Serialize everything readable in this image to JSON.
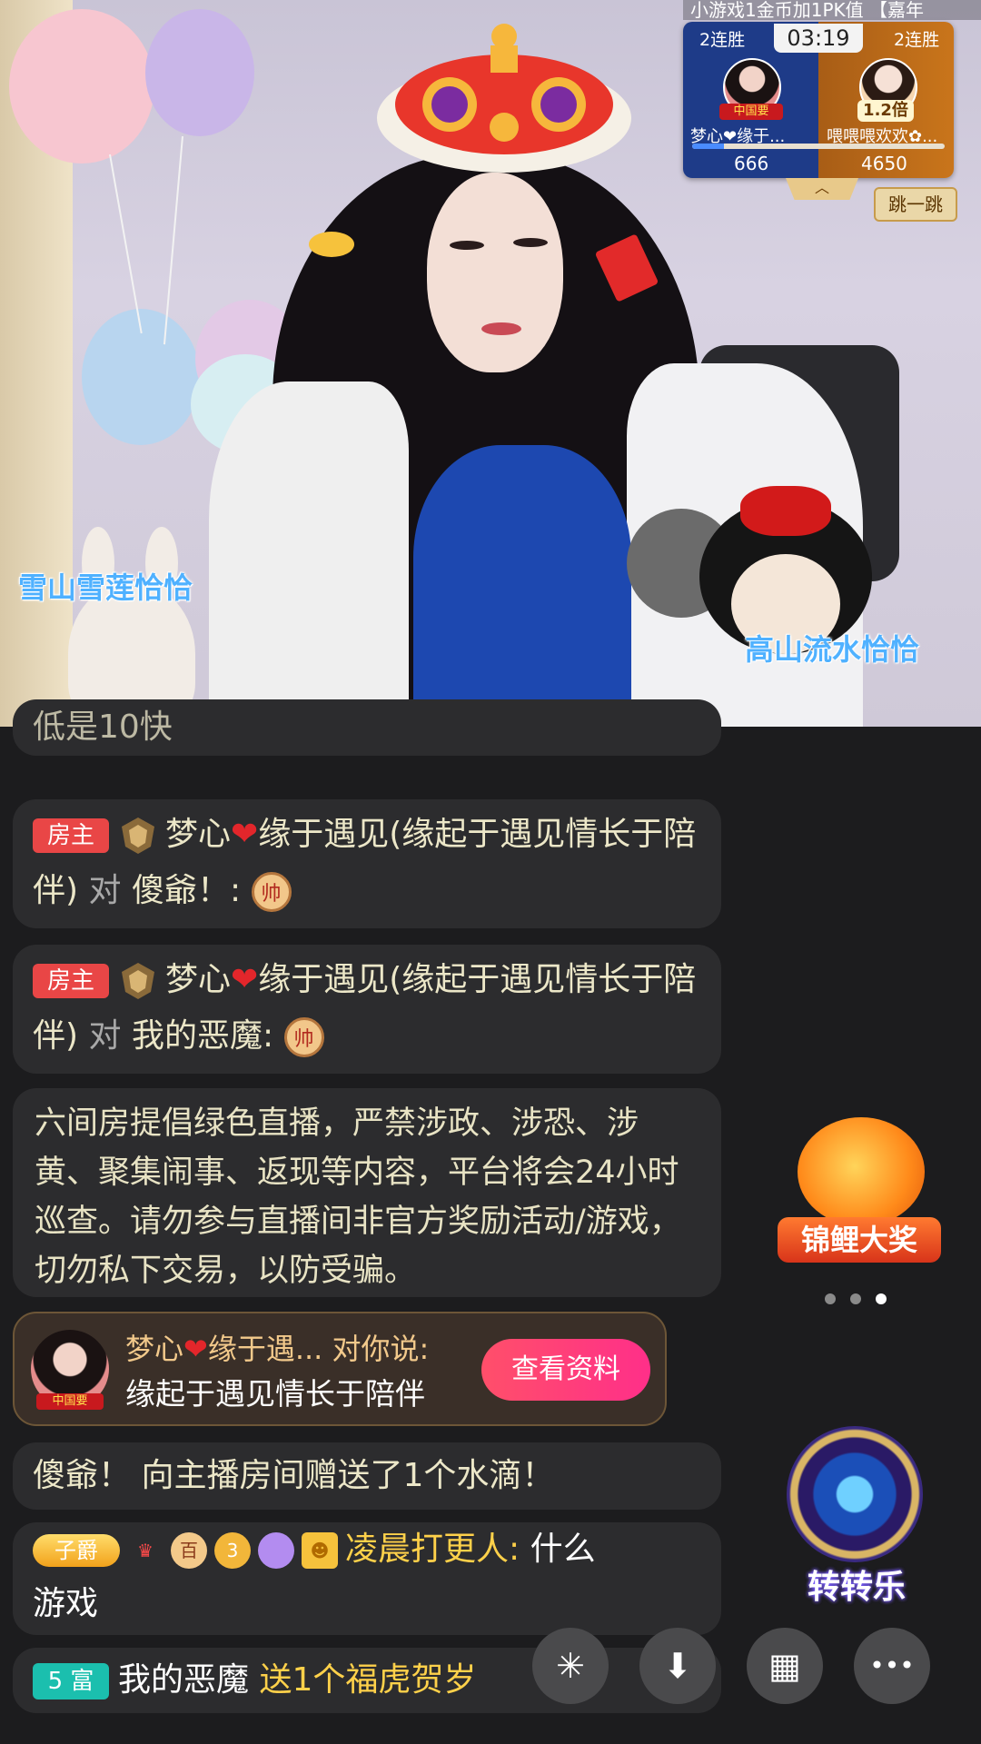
{
  "video": {
    "ticker_text": "小游戏1金币加1PK值 【嘉年",
    "overlay_name_left": "雪山雪莲恰恰",
    "overlay_name_right": "高山流水恰恰"
  },
  "pk": {
    "left_streak": "2连胜",
    "right_streak": "2连胜",
    "timer": "03:19",
    "left_tag": "中国要",
    "multiplier": "1.2倍",
    "left_name": "梦心❤缘于...",
    "right_name": "喂喂喂欢欢✿...",
    "left_score": "666",
    "right_score": "4650",
    "progress": 0.125,
    "expand_glyph": "︿",
    "skip_label": "跳一跳",
    "colors": {
      "left_team": "#1e3b88",
      "right_team": "#c9751b",
      "bar": "#4a8cff"
    }
  },
  "chat": {
    "partial_top": "低是10快",
    "messages": [
      {
        "badge": "房主",
        "sender_prefix": "梦心",
        "heart": "❤",
        "sender_rest": "缘于遇见(缘起于遇见情长于陪伴)",
        "connector": "对",
        "target": "傻爺！:",
        "gift_glyph": "帅"
      },
      {
        "badge": "房主",
        "sender_prefix": "梦心",
        "heart": "❤",
        "sender_rest": "缘于遇见(缘起于遇见情长于陪伴)",
        "connector": "对",
        "target": "我的恶魔:",
        "gift_glyph": "帅"
      }
    ],
    "notice": "六间房提倡绿色直播，严禁涉政、涉恐、涉黄、聚集闹事、返现等内容，平台将会24小时巡查。请勿参与直播间非官方奖励活动/游戏，切勿私下交易，以防受骗。",
    "private": {
      "avatar_tag": "中国要",
      "sender_prefix": "梦心",
      "heart": "❤",
      "sender_rest": "缘于遇... 对你说:",
      "content": "缘起于遇见情长于陪伴",
      "button_label": "查看资料"
    },
    "gift_line": "傻爺！ 向主播房间赠送了1个水滴！",
    "user_msg": {
      "level_badge": "子爵",
      "icon_hundred": "百",
      "icon_three": "3",
      "username": "凌晨打更人:",
      "text_part1": "什么",
      "text_part2": "游戏"
    },
    "rich_msg": {
      "badge": "5 富",
      "username": "我的恶魔",
      "action": "送1个福虎贺岁"
    }
  },
  "widgets": {
    "koi_label": "锦鲤大奖",
    "wheel_label": "转转乐"
  },
  "toolbar": {
    "share_glyph": "✳",
    "download_glyph": "⬇",
    "grid_glyph": "▦",
    "more_glyph": "•••"
  }
}
